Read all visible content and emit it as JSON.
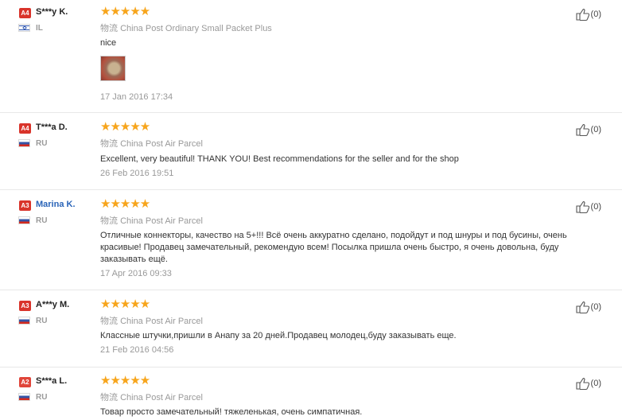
{
  "reviews": [
    {
      "level": "A4",
      "name": "S***y K.",
      "country": "IL",
      "flag_icon": "israel-flag-icon",
      "stars": "★★★★★",
      "rating": 5,
      "shipping_cn": "物流",
      "shipping": "China Post Ordinary Small Packet Plus",
      "text": "nice",
      "has_photo": true,
      "date": "17 Jan 2016 17:34",
      "useful": "(0)"
    },
    {
      "level": "A4",
      "name": "T***a D.",
      "country": "RU",
      "flag_icon": "russia-flag-icon",
      "stars": "★★★★★",
      "rating": 5,
      "shipping_cn": "物流",
      "shipping": "China Post Air Parcel",
      "text": "Excellent, very beautiful! THANK YOU! Best recommendations for the seller and for the shop",
      "date": "26 Feb 2016 19:51",
      "useful": "(0)"
    },
    {
      "level": "A3",
      "name": "Marina K.",
      "country": "RU",
      "flag_icon": "russia-flag-icon",
      "stars": "★★★★★",
      "rating": 5,
      "shipping_cn": "物流",
      "shipping": "China Post Air Parcel",
      "text": "Отличные коннекторы, качество на 5+!!! Всё очень аккуратно сделано, подойдут и под шнуры и под бусины, очень красивые! Продавец замечательный, рекомендую всем! Посылка пришла очень быстро, я очень довольна, буду заказывать ещё.",
      "date": "17 Apr 2016 09:33",
      "useful": "(0)"
    },
    {
      "level": "A3",
      "name": "A***y M.",
      "country": "RU",
      "flag_icon": "russia-flag-icon",
      "stars": "★★★★★",
      "rating": 5,
      "shipping_cn": "物流",
      "shipping": "China Post Air Parcel",
      "text": "Классные штучки,пришли в Анапу за 20 дней.Продавец молодец,буду заказывать еще.",
      "date": "21 Feb 2016 04:56",
      "useful": "(0)"
    },
    {
      "level": "A2",
      "name": "S***a L.",
      "country": "RU",
      "flag_icon": "russia-flag-icon",
      "stars": "★★★★★",
      "rating": 5,
      "shipping_cn": "物流",
      "shipping": "China Post Air Parcel",
      "text": "Товар просто замечательный! тяжеленькая, очень симпатичная.",
      "date": "",
      "useful": "(0)"
    }
  ],
  "colors": {
    "star": "#f7a51c",
    "badge": "#d9342b",
    "link": "#2a64b8",
    "muted": "#999999"
  },
  "icons": {
    "useful": "thumbs-up-icon"
  }
}
